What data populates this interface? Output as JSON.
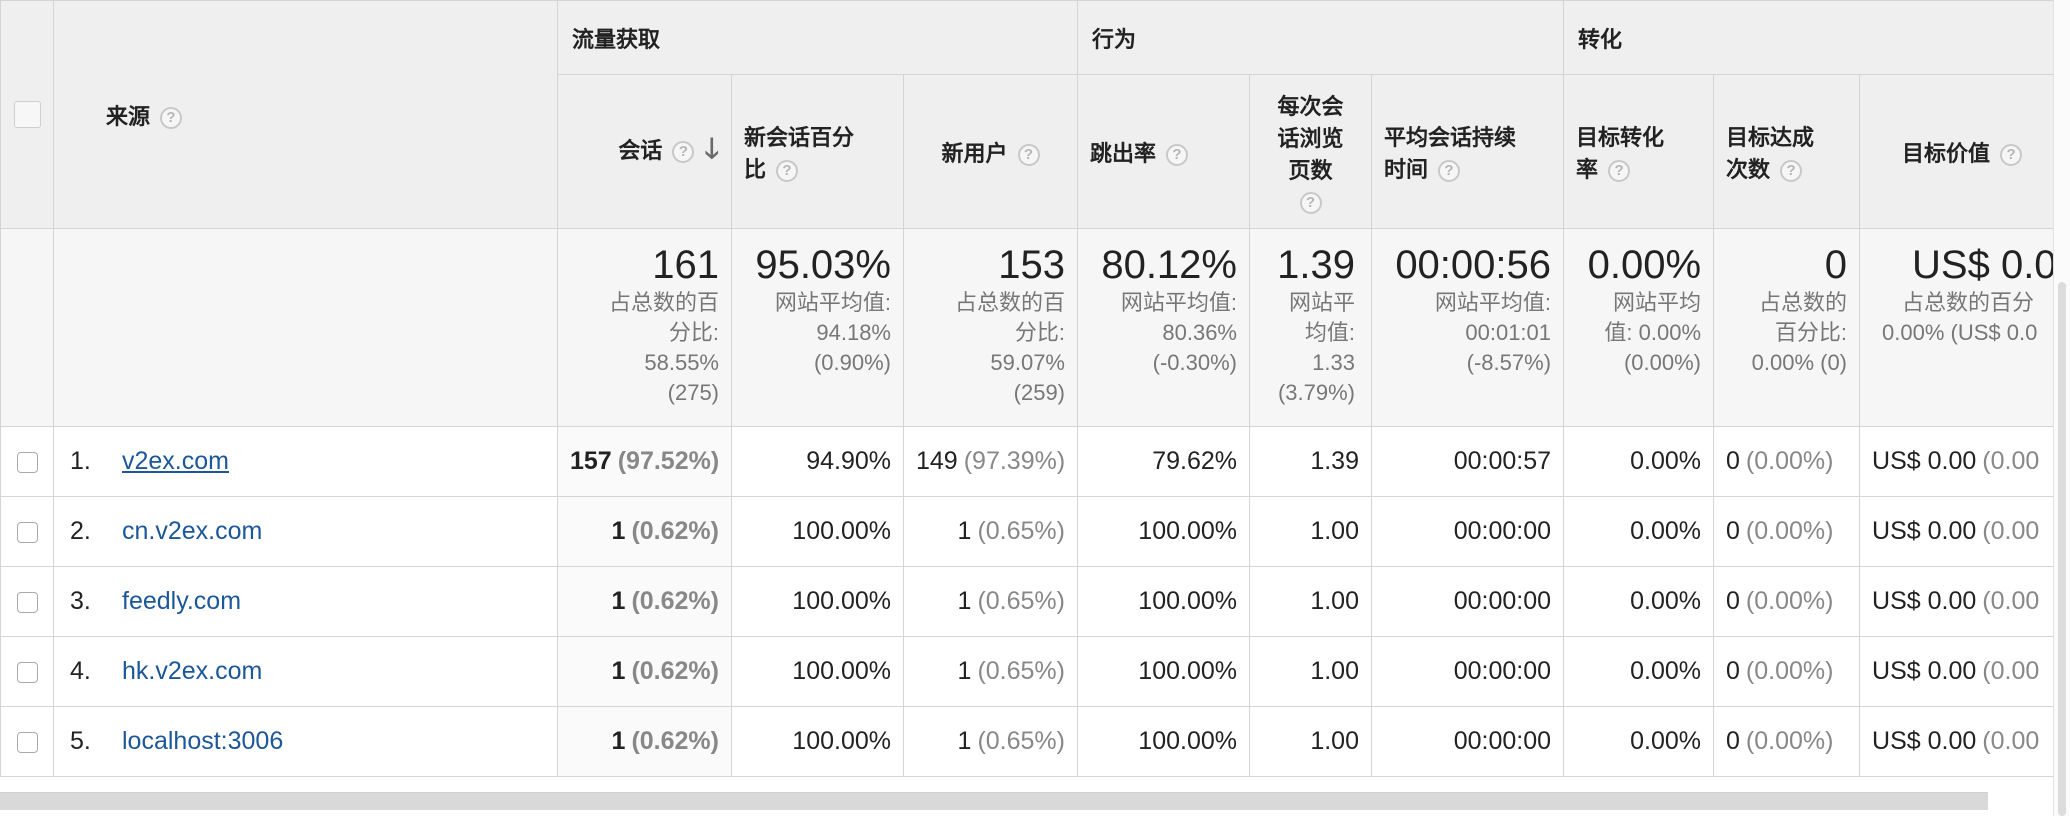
{
  "headers": {
    "group_acquisition": "流量获取",
    "group_behavior": "行为",
    "group_conversion": "转化",
    "source": "来源",
    "sessions": "会话",
    "new_session_pct_1": "新会话百分",
    "new_session_pct_2": "比",
    "new_users": "新用户",
    "bounce_rate": "跳出率",
    "pages_per_session_1": "每次会",
    "pages_per_session_2": "话浏览",
    "pages_per_session_3": "页数",
    "avg_duration_1": "平均会话持续",
    "avg_duration_2": "时间",
    "goal_conv_rate_1": "目标转化",
    "goal_conv_rate_2": "率",
    "goal_completions_1": "目标达成",
    "goal_completions_2": "次数",
    "goal_value": "目标价值",
    "help_glyph": "?",
    "sort_glyph": "🡓"
  },
  "summary": {
    "sessions": {
      "value": "161",
      "l1": "占总数的百",
      "l2": "分比:",
      "l3": "58.55%",
      "l4": "(275)"
    },
    "new_session_pct": {
      "value": "95.03%",
      "l1": "网站平均值:",
      "l2": "94.18%",
      "l3": "(0.90%)"
    },
    "new_users": {
      "value": "153",
      "l1": "占总数的百",
      "l2": "分比:",
      "l3": "59.07%",
      "l4": "(259)"
    },
    "bounce_rate": {
      "value": "80.12%",
      "l1": "网站平均值:",
      "l2": "80.36%",
      "l3": "(-0.30%)"
    },
    "pages_per_session": {
      "value": "1.39",
      "l1": "网站平",
      "l2": "均值:",
      "l3": "1.33",
      "l4": "(3.79%)"
    },
    "avg_duration": {
      "value": "00:00:56",
      "l1": "网站平均值:",
      "l2": "00:01:01",
      "l3": "(-8.57%)"
    },
    "goal_conv_rate": {
      "value": "0.00%",
      "l1": "网站平均",
      "l2": "值: 0.00%",
      "l3": "(0.00%)"
    },
    "goal_completions": {
      "value": "0",
      "l1": "占总数的",
      "l2": "百分比:",
      "l3": "0.00% (0)"
    },
    "goal_value": {
      "value": "US$ 0.0",
      "l1": "占总数的百分",
      "l2": "0.00% (US$ 0.0"
    }
  },
  "rows": [
    {
      "rank": "1.",
      "source": "v2ex.com",
      "sessions": "157",
      "sessions_pct": "(97.52%)",
      "new_session_pct": "94.90%",
      "new_users": "149",
      "new_users_pct": "(97.39%)",
      "bounce_rate": "79.62%",
      "pages": "1.39",
      "duration": "00:00:57",
      "goal_rate": "0.00%",
      "goal_completions": "0",
      "goal_completions_pct": "(0.00%)",
      "goal_value": "US$ 0.00",
      "goal_value_pct": "(0.00"
    },
    {
      "rank": "2.",
      "source": "cn.v2ex.com",
      "sessions": "1",
      "sessions_pct": "(0.62%)",
      "new_session_pct": "100.00%",
      "new_users": "1",
      "new_users_pct": "(0.65%)",
      "bounce_rate": "100.00%",
      "pages": "1.00",
      "duration": "00:00:00",
      "goal_rate": "0.00%",
      "goal_completions": "0",
      "goal_completions_pct": "(0.00%)",
      "goal_value": "US$ 0.00",
      "goal_value_pct": "(0.00"
    },
    {
      "rank": "3.",
      "source": "feedly.com",
      "sessions": "1",
      "sessions_pct": "(0.62%)",
      "new_session_pct": "100.00%",
      "new_users": "1",
      "new_users_pct": "(0.65%)",
      "bounce_rate": "100.00%",
      "pages": "1.00",
      "duration": "00:00:00",
      "goal_rate": "0.00%",
      "goal_completions": "0",
      "goal_completions_pct": "(0.00%)",
      "goal_value": "US$ 0.00",
      "goal_value_pct": "(0.00"
    },
    {
      "rank": "4.",
      "source": "hk.v2ex.com",
      "sessions": "1",
      "sessions_pct": "(0.62%)",
      "new_session_pct": "100.00%",
      "new_users": "1",
      "new_users_pct": "(0.65%)",
      "bounce_rate": "100.00%",
      "pages": "1.00",
      "duration": "00:00:00",
      "goal_rate": "0.00%",
      "goal_completions": "0",
      "goal_completions_pct": "(0.00%)",
      "goal_value": "US$ 0.00",
      "goal_value_pct": "(0.00"
    },
    {
      "rank": "5.",
      "source": "localhost:3006",
      "sessions": "1",
      "sessions_pct": "(0.62%)",
      "new_session_pct": "100.00%",
      "new_users": "1",
      "new_users_pct": "(0.65%)",
      "bounce_rate": "100.00%",
      "pages": "1.00",
      "duration": "00:00:00",
      "goal_rate": "0.00%",
      "goal_completions": "0",
      "goal_completions_pct": "(0.00%)",
      "goal_value": "US$ 0.00",
      "goal_value_pct": "(0.00"
    }
  ]
}
